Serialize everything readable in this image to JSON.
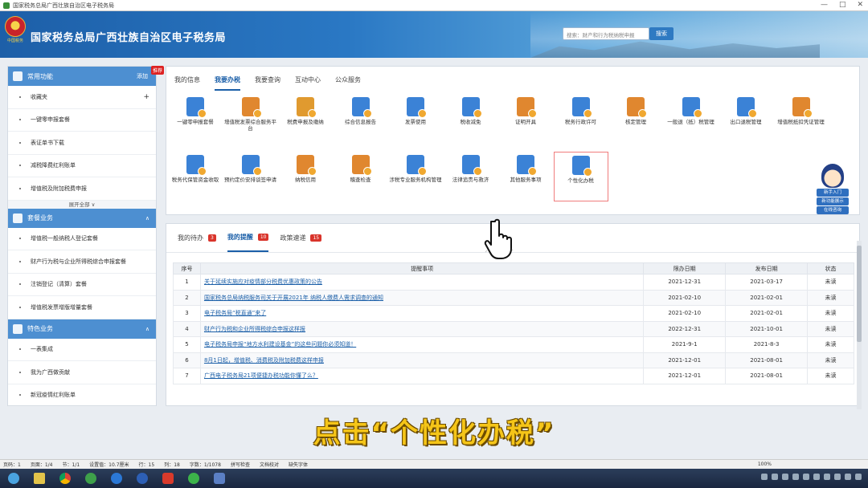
{
  "window": {
    "title": "国家税务总局广西壮族自治区电子税务局",
    "controls": [
      "—",
      "□",
      "✕"
    ]
  },
  "header": {
    "site_title": "国家税务总局广西壮族自治区电子税务局",
    "emblem_sub": "中国税务",
    "search_placeholder": "搜索：财产和行为税纳税申报",
    "search_button": "搜索"
  },
  "sidebar": {
    "sections": [
      {
        "title": "常用功能",
        "action": "添加",
        "tag": "推荐",
        "items": [
          "收藏夹",
          "一键零申报套餐",
          "表证单书下载",
          "减税降费红利账单",
          "增值税及附加税费申报"
        ],
        "expand": "展开全部 ∨"
      },
      {
        "title": "套餐业务",
        "action": "∧",
        "items": [
          "增值税一般纳税人登记套餐",
          "财产行为税与企业所得税综合申报套餐",
          "注销登记（清算）套餐",
          "增值税发票增版增量套餐"
        ]
      },
      {
        "title": "特色业务",
        "action": "∧",
        "items": [
          "一表集成",
          "我为广西做贡献",
          "新冠疫情红利账单"
        ]
      }
    ]
  },
  "main": {
    "tabs": [
      "我的信息",
      "我要办税",
      "我要查询",
      "互动中心",
      "公众服务"
    ],
    "active_tab": "我要办税",
    "tiles": [
      {
        "label": "一键零申报套餐",
        "color": "#3b82d6"
      },
      {
        "label": "增值税发票综合服务平台",
        "color": "#e0872f"
      },
      {
        "label": "税费申报及缴纳",
        "color": "#e09a2f"
      },
      {
        "label": "综合信息报告",
        "color": "#3b82d6"
      },
      {
        "label": "发票使用",
        "color": "#3b82d6"
      },
      {
        "label": "税收减免",
        "color": "#3b82d6"
      },
      {
        "label": "证明开具",
        "color": "#e0872f"
      },
      {
        "label": "税务行政许可",
        "color": "#3b82d6"
      },
      {
        "label": "核定管理",
        "color": "#e0872f"
      },
      {
        "label": "一般退（抵）税管理",
        "color": "#3b82d6"
      },
      {
        "label": "出口退税管理",
        "color": "#3b82d6"
      },
      {
        "label": "增值税抵扣凭证管理",
        "color": "#e0872f"
      },
      {
        "label": "税务代保管资金收取",
        "color": "#3b82d6"
      },
      {
        "label": "预约定价安排谈签申请",
        "color": "#3b82d6"
      },
      {
        "label": "纳税信用",
        "color": "#e0872f"
      },
      {
        "label": "稽查检查",
        "color": "#e0872f"
      },
      {
        "label": "涉税专业服务机构管理",
        "color": "#3b82d6"
      },
      {
        "label": "法律追责与救济",
        "color": "#3b82d6"
      },
      {
        "label": "其他服务事项",
        "color": "#3b82d6"
      },
      {
        "label": "个性化办税",
        "color": "#3b82d6"
      }
    ],
    "highlight_tile": "个性化办税"
  },
  "mascot": {
    "buttons": [
      "新手入门",
      "新功能展示",
      "在线咨询"
    ]
  },
  "notices": {
    "tabs": [
      {
        "label": "我的待办",
        "count": "3"
      },
      {
        "label": "我的提醒",
        "count": "10"
      },
      {
        "label": "政策速递",
        "count": "15"
      }
    ],
    "active_tab": "我的提醒",
    "columns": [
      "序号",
      "提醒事项",
      "限办日期",
      "发布日期",
      "状态"
    ],
    "rows": [
      [
        "1",
        "关于延续实施应对疫情部分税费优惠政策的公告",
        "2021-12-31",
        "2021-03-17",
        "未读"
      ],
      [
        "2",
        "国家税务总局纳税服务司关于开展2021年 纳税人缴费人需求调查的通知",
        "2021-02-10",
        "2021-02-01",
        "未读"
      ],
      [
        "3",
        "电子税务局“税直通”来了",
        "2021-02-10",
        "2021-02-01",
        "未读"
      ],
      [
        "4",
        "财产行为税和企业所得税综合申报这样报",
        "2022-12-31",
        "2021-10-01",
        "未读"
      ],
      [
        "5",
        "电子税务局申报“地方水利建设基金”的这些问题你必须知道！",
        "2021-9-1",
        "2021-8-3",
        "未读"
      ],
      [
        "6",
        "8月1日起，增值税、消费税及附加税费这样申报",
        "2021-12-01",
        "2021-08-01",
        "未读"
      ],
      [
        "7",
        "广西电子税务局21项便捷办税功能你懂了么？",
        "2021-12-01",
        "2021-08-01",
        "未读"
      ]
    ]
  },
  "caption": "点击“个性化办税”",
  "statusbar": {
    "items": [
      "页码：1",
      "页面：1/4",
      "节：1/1",
      "设置值：10.7厘米",
      "行：15",
      "列：18",
      "字数：1/1078",
      "拼写检查",
      "文档校对",
      "缺失字体"
    ],
    "zoom": "100%"
  },
  "colors": {
    "accent": "#1b5fa8",
    "banner": "#2a78c4",
    "badge": "#d9342b",
    "caption": "#f5c518"
  }
}
